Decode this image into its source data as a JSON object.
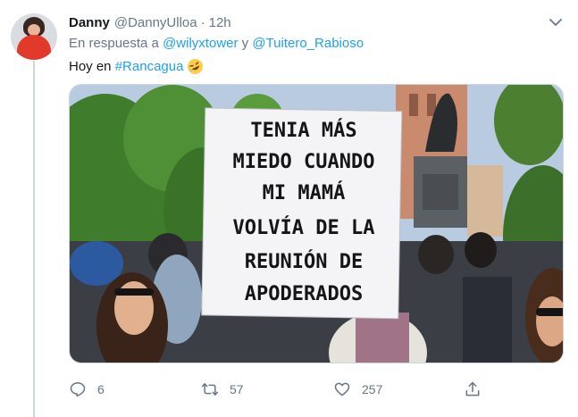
{
  "tweet": {
    "name": "Danny",
    "handle": "@DannyUlloa",
    "separator": "·",
    "time": "12h",
    "reply_prefix": "En respuesta a",
    "reply_user1": "@wilyxtower",
    "reply_conj": "y",
    "reply_user2": "@Tuitero_Rabioso",
    "text": "Hoy en",
    "hashtag": "#Rancagua",
    "emoji": "rolling-on-floor-laughing-emoji",
    "sign_lines": [
      "TENIA MÁS",
      "MIEDO CUANDO",
      "MI MAMÁ",
      "VOLVÍA DE LA",
      "REUNIÓN DE",
      "APODERADOS"
    ]
  },
  "actions": {
    "replies": "6",
    "retweets": "57",
    "likes": "257"
  },
  "colors": {
    "accent": "#1da1f2",
    "muted": "#657786",
    "line": "#ccd6dd"
  }
}
